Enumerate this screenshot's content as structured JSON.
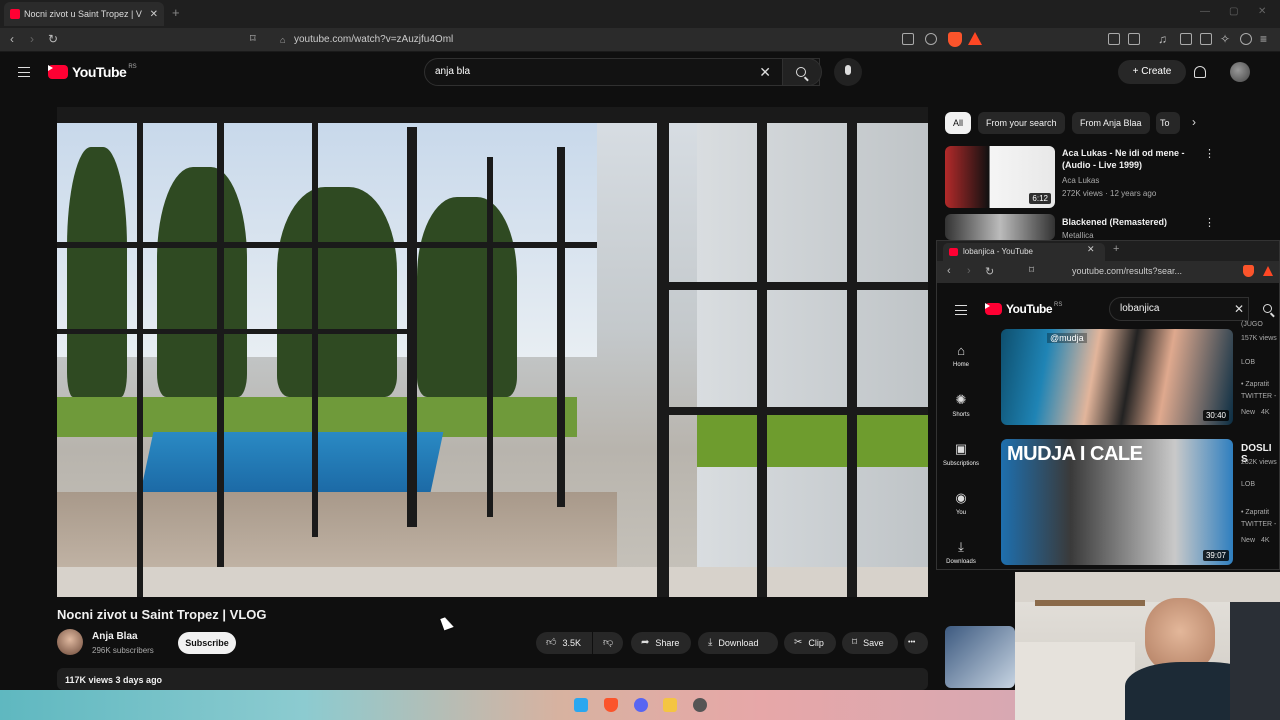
{
  "browser": {
    "tab_title": "Nocni zivot u Saint Tropez | V",
    "url": "youtube.com/watch?v=zAuzjfu4Oml"
  },
  "header": {
    "logo_text": "YouTube",
    "region": "RS",
    "search_value": "anja bla",
    "create_label": "Create"
  },
  "video": {
    "title": "Nocni zivot u Saint Tropez | VLOG",
    "channel": "Anja Blaa",
    "subscribers": "296K subscribers",
    "subscribe_label": "Subscribe",
    "likes": "3.5K",
    "share_label": "Share",
    "download_label": "Download",
    "clip_label": "Clip",
    "save_label": "Save",
    "more_label": "•••",
    "meta": "117K views  3 days ago"
  },
  "chips": [
    "All",
    "From your search",
    "From Anja Blaa",
    "To"
  ],
  "recommendations": [
    {
      "title_line1": "Aca Lukas - Ne idi od mene -",
      "title_line2": "(Audio - Live 1999)",
      "channel": "Aca Lukas",
      "meta": "272K views · 12 years ago",
      "duration": "6:12"
    },
    {
      "title_line1": "Blackened (Remastered)",
      "channel": "Metallica"
    }
  ],
  "overlay": {
    "tab_title": "lobanjica - YouTube",
    "url": "youtube.com/results?sear...",
    "logo_text": "YouTube",
    "region": "RS",
    "search_value": "lobanjica",
    "nav": [
      {
        "icon": "⌂",
        "label": "Home"
      },
      {
        "icon": "✺",
        "label": "Shorts"
      },
      {
        "icon": "▣",
        "label": "Subscriptions"
      },
      {
        "icon": "◉",
        "label": "You"
      },
      {
        "icon": "⤓",
        "label": "Downloads"
      }
    ],
    "results": [
      {
        "handle": "@mudja",
        "duration": "30:40",
        "side_top": "157K views",
        "side_channel": "LOB",
        "side_l1": "• Zapratit",
        "side_l2": "TWITTER -",
        "badge_new": "New",
        "badge_4k": "4K"
      },
      {
        "thumb_text": "MUDJA I CALE",
        "duration": "39:07",
        "side_title": "DOSLI S",
        "side_top": "282K views",
        "side_channel": "LOB",
        "side_l1": "• Zapratit",
        "side_l2": "TWITTER -",
        "badge_new": "New",
        "badge_4k": "4K"
      }
    ],
    "top_clip": "(JUGO"
  },
  "colors": {
    "yt_red": "#ff0033",
    "bg": "#0f0f0f",
    "pill": "#272727"
  }
}
